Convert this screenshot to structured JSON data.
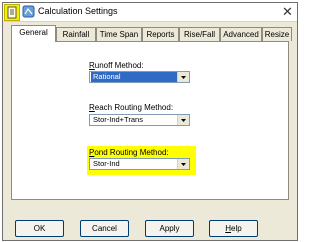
{
  "window": {
    "title": "Calculation Settings",
    "close_label": "✕"
  },
  "tabs": [
    {
      "label": "General"
    },
    {
      "label": "Rainfall"
    },
    {
      "label": "Time Span"
    },
    {
      "label": "Reports"
    },
    {
      "label": "Rise/Fall"
    },
    {
      "label": "Advanced"
    },
    {
      "label": "Resize"
    }
  ],
  "active_tab": "General",
  "fields": {
    "runoff": {
      "label_first": "R",
      "label_rest": "unoff Method:",
      "value": "Rational"
    },
    "reach": {
      "label_first": "R",
      "label_rest": "each Routing Method:",
      "value": "Stor-Ind+Trans"
    },
    "pond": {
      "label_first": "P",
      "label_rest": "ond Routing Method:",
      "value": "Stor-Ind"
    }
  },
  "buttons": {
    "ok": "OK",
    "cancel": "Cancel",
    "apply": "Apply",
    "help_first": "H",
    "help_rest": "elp"
  },
  "colors": {
    "highlight": "#ffff00",
    "selection": "#316ac5",
    "dialog_bg": "#ece9d8"
  }
}
